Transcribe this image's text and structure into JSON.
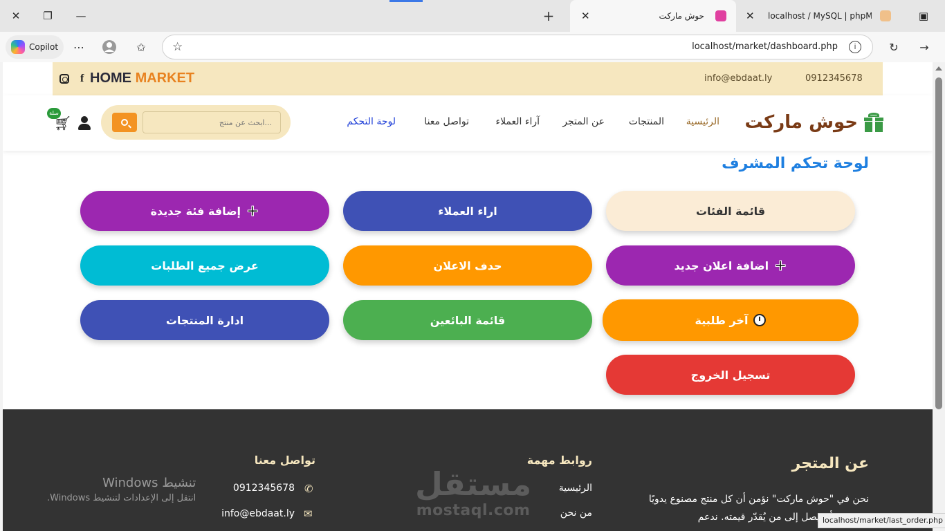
{
  "browser": {
    "tabs": [
      {
        "title": "localhost / MySQL | phpMyA",
        "active": false
      },
      {
        "title": "حوش ماركت",
        "active": true
      }
    ],
    "copilot_label": "Copilot",
    "url": "localhost/market/dashboard.php",
    "status_url": "localhost/market/last_order.php"
  },
  "topbar": {
    "brand_home": "HOME",
    "brand_market": "MARKET",
    "email": "info@ebdaat.ly",
    "phone": "0912345678"
  },
  "nav": {
    "logo_text": "حوش ماركت",
    "links": [
      "الرئيسية",
      "المنتجات",
      "عن المتجر",
      "آراء العملاء",
      "تواصل معنا",
      "لوحة التحكم"
    ],
    "search_placeholder": "ابحث عن منتج...",
    "cart_badge": "سلة"
  },
  "dashboard": {
    "title": "لوحة تحكم المشرف",
    "buttons": [
      {
        "label": "قائمة الفئات",
        "color": "#fbecd6",
        "text_color": "#333333"
      },
      {
        "label": "اراء العملاء",
        "color": "#3f51b5"
      },
      {
        "label": "إضافة فئة جديدة",
        "color": "#9c27b0",
        "icon": "plus-icon"
      },
      {
        "label": "اضافة اعلان جديد",
        "color": "#9c27b0",
        "icon": "plus-icon"
      },
      {
        "label": "حدف الاعلان",
        "color": "#ff9800"
      },
      {
        "label": "عرض جميع الطلبات",
        "color": "#00bcd4"
      },
      {
        "label": "آخر طلبية",
        "color": "#ff9800",
        "icon": "timer-icon"
      },
      {
        "label": "قائمة البائعين",
        "color": "#4caf50"
      },
      {
        "label": "ادارة المنتجات",
        "color": "#3f51b5"
      },
      {
        "label": "تسجيل الخروج",
        "color": "#e53935"
      }
    ]
  },
  "footer": {
    "about_title": "عن المتجر",
    "about_line1": "نحن في \"حوش ماركت\" نؤمن أن كل منتج مصنوع يدويًا",
    "about_line2": "ويستحق أن يصل إلى من يُقدّر قيمته. ندعم",
    "links_title": "روابط مهمة",
    "links": [
      "الرئيسية",
      "من نحن"
    ],
    "contact_title": "تواصل معنا",
    "phone": "0912345678",
    "email": "info@ebdaat.ly",
    "watermark_ar": "مستقل",
    "watermark_en": "mostaql.com",
    "activation_title": "تنشيط Windows",
    "activation_sub": "انتقل إلى الإعدادات لتنشيط Windows."
  }
}
